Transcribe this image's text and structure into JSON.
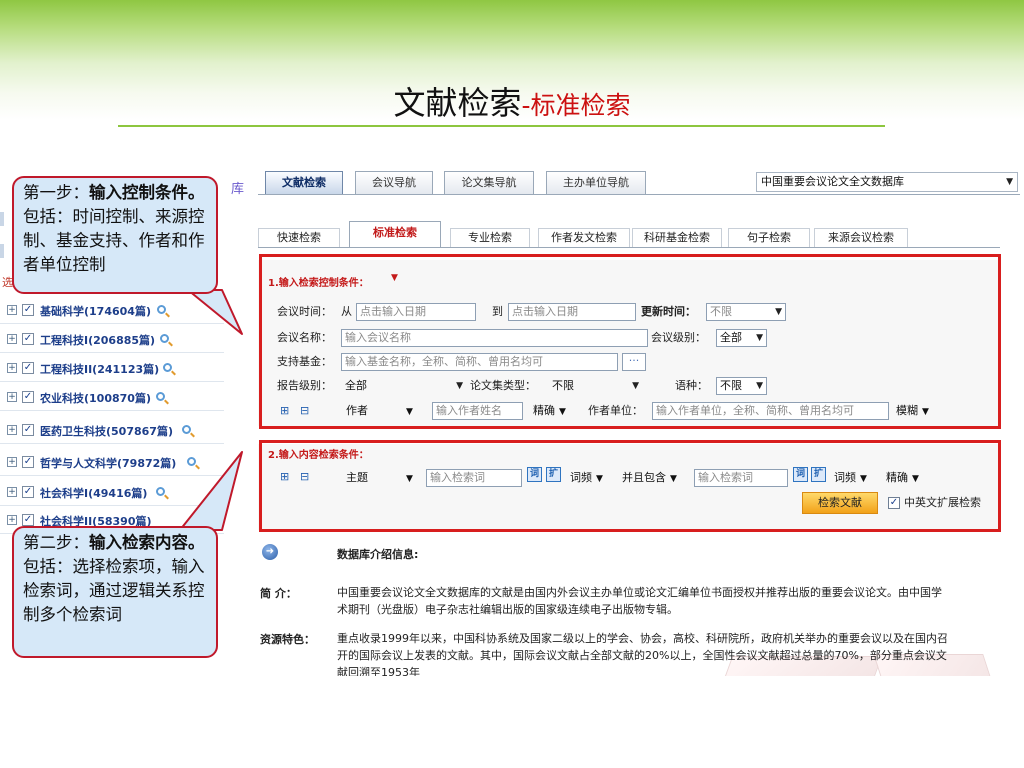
{
  "slide": {
    "title_main": "文献检索",
    "title_sub": "-标准检索"
  },
  "sidebar": {
    "fragment_ku": "库",
    "fragment_xuan": "选",
    "items": [
      {
        "label": "基础科学(174604篇)"
      },
      {
        "label": "工程科技I(206885篇)"
      },
      {
        "label": "工程科技II(241123篇)"
      },
      {
        "label": "农业科技(100870篇)"
      },
      {
        "label": "医药卫生科技(507867篇)"
      },
      {
        "label": "哲学与人文科学(79872篇)"
      },
      {
        "label": "社会科学I(49416篇)"
      },
      {
        "label": "社会科学II(58390篇)"
      }
    ]
  },
  "nav": {
    "tabs": [
      "文献检索",
      "会议导航",
      "论文集导航",
      "主办单位导航"
    ],
    "database_select": "中国重要会议论文全文数据库"
  },
  "search_tabs": [
    "快速检索",
    "标准检索",
    "专业检索",
    "作者发文检索",
    "科研基金检索",
    "句子检索",
    "来源会议检索"
  ],
  "control": {
    "section_title": "1.输入检索控制条件：",
    "meeting_time_label": "会议时间：",
    "from_label": "从",
    "date_from_placeholder": "点击输入日期",
    "to_label": "到",
    "date_to_placeholder": "点击输入日期",
    "update_time_label": "更新时间：",
    "update_time_value": "不限",
    "meeting_name_label": "会议名称：",
    "meeting_name_placeholder": "输入会议名称",
    "meeting_level_label": "会议级别：",
    "meeting_level_value": "全部",
    "fund_label": "支持基金：",
    "fund_placeholder": "输入基金名称，全称、简称、曾用名均可",
    "fund_button": "···",
    "report_level_label": "报告级别：",
    "report_level_value": "全部",
    "collection_type_label": "论文集类型：",
    "collection_type_value": "不限",
    "language_label": "语种：",
    "language_value": "不限",
    "plus": "⊞",
    "minus": "⊟",
    "author_field": "作者",
    "author_placeholder": "输入作者姓名",
    "author_match": "精确",
    "author_unit_label": "作者单位：",
    "author_unit_placeholder": "输入作者单位，全称、简称、曾用名均可",
    "author_unit_match": "模糊"
  },
  "content": {
    "section_title": "2.输入内容检索条件：",
    "plus": "⊞",
    "minus": "⊟",
    "field1": "主题",
    "keyword1_placeholder": "输入检索词",
    "freq1": "词频",
    "logic": "并且包含",
    "keyword2_placeholder": "输入检索词",
    "freq2": "词频",
    "match": "精确",
    "search_button": "检索文献",
    "expand_label": "中英文扩展检索"
  },
  "info": {
    "heading": "数据库介绍信息:",
    "intro_label": "简 介：",
    "intro_line1": "中国重要会议论文全文数据库的文献是由国内外会议主办单位或论文汇编单位书面授权并推荐出版的重要会议论文。由中国学",
    "intro_line2": "术期刊（光盘版）电子杂志社编辑出版的国家级连续电子出版物专辑。",
    "feature_label": "资源特色：",
    "feature_line1": "重点收录1999年以来，中国科协系统及国家二级以上的学会、协会，高校、科研院所，政府机关举办的重要会议以及在国内召",
    "feature_line2": "开的国际会议上发表的文献。其中，国际会议文献占全部文献的20%以上，全国性会议文献超过总量的70%，部分重点会议文",
    "feature_line3": "献回溯至1953年"
  },
  "callouts": {
    "step1_prefix": "第一步：",
    "step1_bold": "输入控制条件。",
    "step1_text": "包括：时间控制、来源控制、基金支持、作者和作者单位控制",
    "step2_prefix": "第二步：",
    "step2_bold": "输入检索内容。",
    "step2_text": "包括：选择检索项，输入检索词，通过逻辑关系控制多个检索词"
  },
  "colors": {
    "accent_green": "#8dc63f",
    "highlight_red": "#d81e1e",
    "callout_fill": "#d6e8f8"
  }
}
